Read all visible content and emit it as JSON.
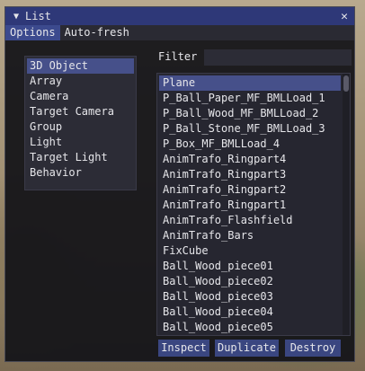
{
  "window": {
    "title": "List",
    "collapse_glyph": "▼",
    "close_glyph": "✕"
  },
  "menu": {
    "options": "Options",
    "auto_fresh": "Auto-fresh"
  },
  "categories": [
    "3D Object",
    "Array",
    "Camera",
    "Target Camera",
    "Group",
    "Light",
    "Target Light",
    "Behavior"
  ],
  "filter": {
    "label": "Filter",
    "value": ""
  },
  "objects": [
    "Plane",
    "P_Ball_Paper_MF_BMLLoad_1",
    "P_Ball_Wood_MF_BMLLoad_2",
    "P_Ball_Stone_MF_BMLLoad_3",
    "P_Box_MF_BMLLoad_4",
    "AnimTrafo_Ringpart4",
    "AnimTrafo_Ringpart3",
    "AnimTrafo_Ringpart2",
    "AnimTrafo_Ringpart1",
    "AnimTrafo_Flashfield",
    "AnimTrafo_Bars",
    "FixCube",
    "Ball_Wood_piece01",
    "Ball_Wood_piece02",
    "Ball_Wood_piece03",
    "Ball_Wood_piece04",
    "Ball_Wood_piece05"
  ],
  "buttons": {
    "inspect": "Inspect",
    "duplicate": "Duplicate",
    "destroy": "Destroy"
  },
  "colors": {
    "title_bar": "#2e3878",
    "selection": "#46508a",
    "button": "#3a4680"
  }
}
